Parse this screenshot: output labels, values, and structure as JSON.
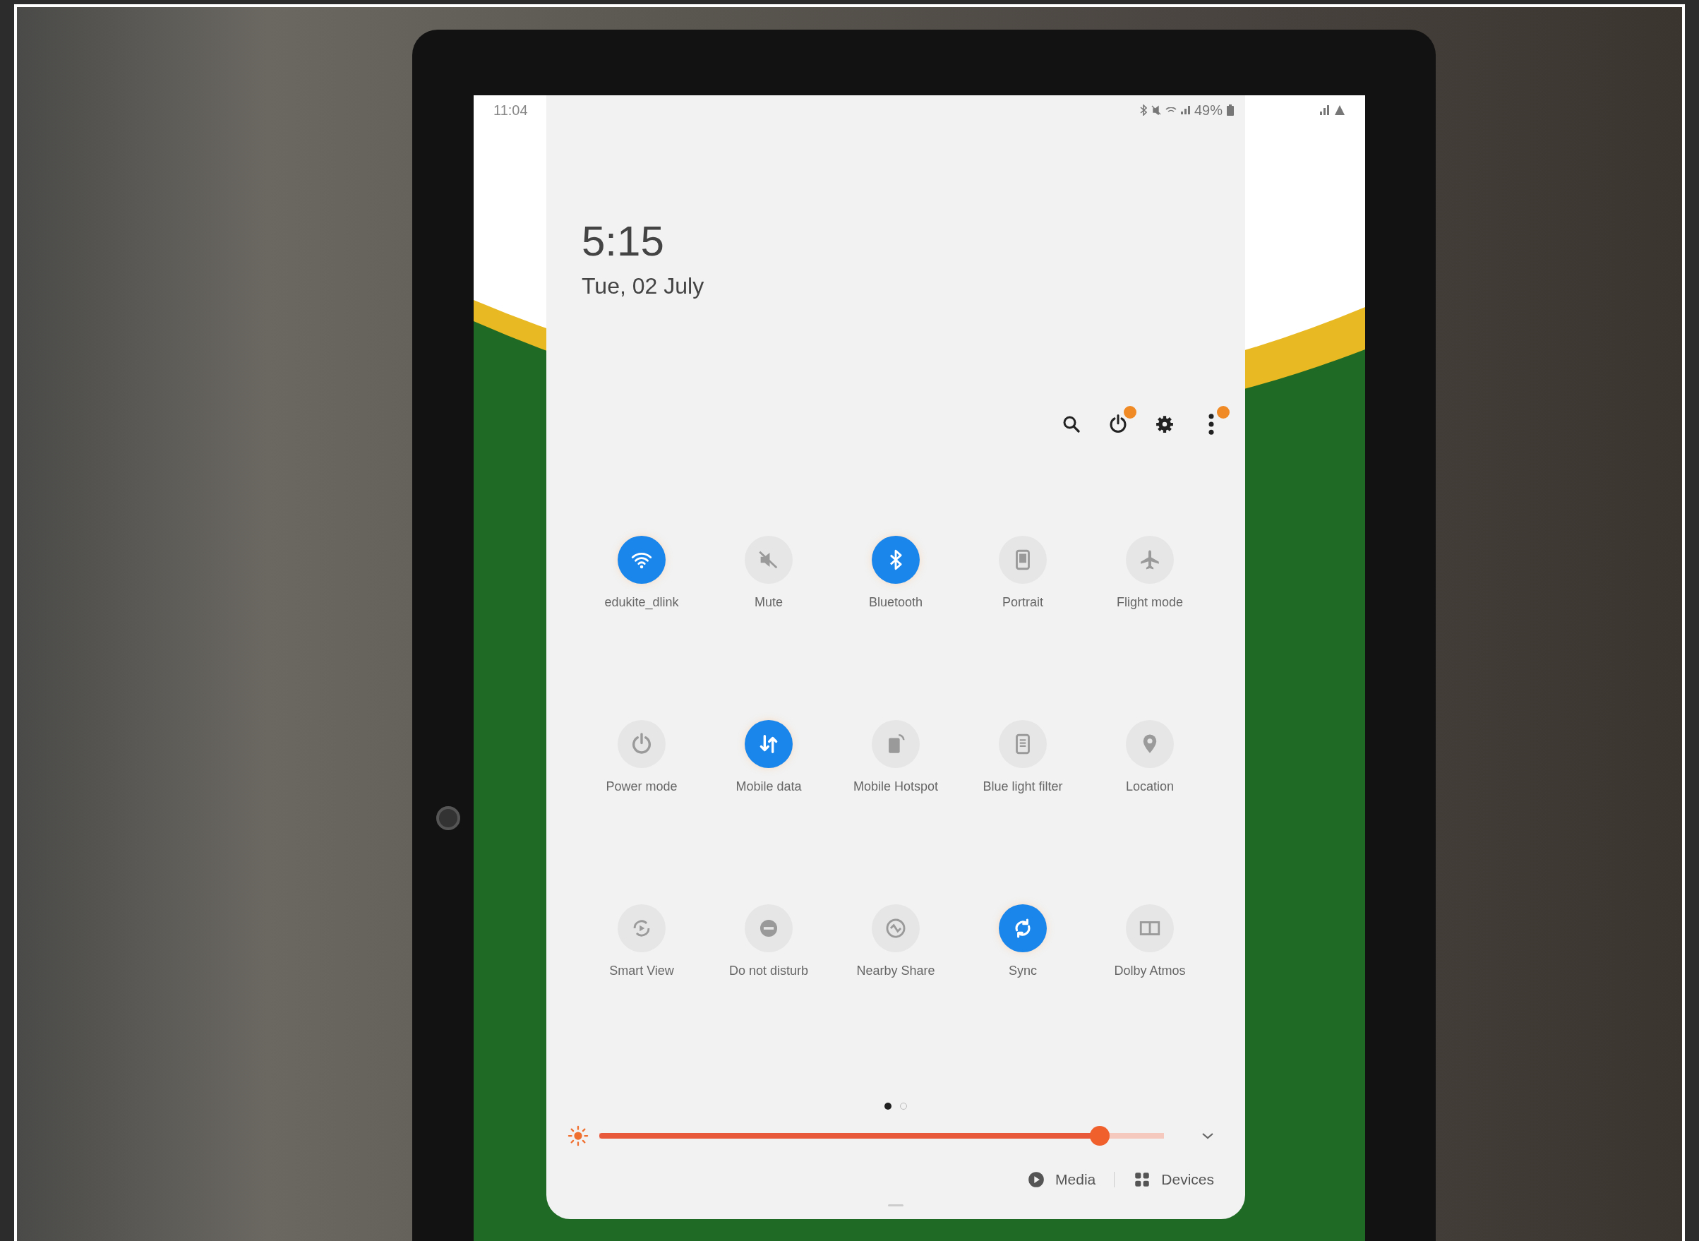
{
  "status_bar": {
    "time": "11:04",
    "battery": "49%"
  },
  "clock": {
    "time": "5:15",
    "date": "Tue, 02 July"
  },
  "header_actions": [
    {
      "kind": "search",
      "badge": false
    },
    {
      "kind": "power",
      "badge": true
    },
    {
      "kind": "settings",
      "badge": false
    },
    {
      "kind": "more",
      "badge": true
    }
  ],
  "tiles": [
    {
      "kind": "wifi",
      "label": "edukite_dlink",
      "on": true
    },
    {
      "kind": "mute",
      "label": "Mute",
      "on": false
    },
    {
      "kind": "bluetooth",
      "label": "Bluetooth",
      "on": true
    },
    {
      "kind": "portrait",
      "label": "Portrait",
      "on": false
    },
    {
      "kind": "flight",
      "label": "Flight mode",
      "on": false
    },
    {
      "kind": "power",
      "label": "Power mode",
      "on": false
    },
    {
      "kind": "data",
      "label": "Mobile data",
      "on": true
    },
    {
      "kind": "hotspot",
      "label": "Mobile Hotspot",
      "on": false
    },
    {
      "kind": "bluelight",
      "label": "Blue light filter",
      "on": false
    },
    {
      "kind": "location",
      "label": "Location",
      "on": false
    },
    {
      "kind": "smartview",
      "label": "Smart View",
      "on": false
    },
    {
      "kind": "dnd",
      "label": "Do not disturb",
      "on": false
    },
    {
      "kind": "nearby",
      "label": "Nearby Share",
      "on": false
    },
    {
      "kind": "sync",
      "label": "Sync",
      "on": true
    },
    {
      "kind": "dolby",
      "label": "Dolby Atmos",
      "on": false
    }
  ],
  "pages": [
    {
      "selected": true
    },
    {
      "selected": false
    }
  ],
  "brightness": {
    "level": 0.9
  },
  "buttons": [
    {
      "kind": "media",
      "label": "Media"
    },
    {
      "kind": "devices",
      "label": "Devices"
    }
  ]
}
